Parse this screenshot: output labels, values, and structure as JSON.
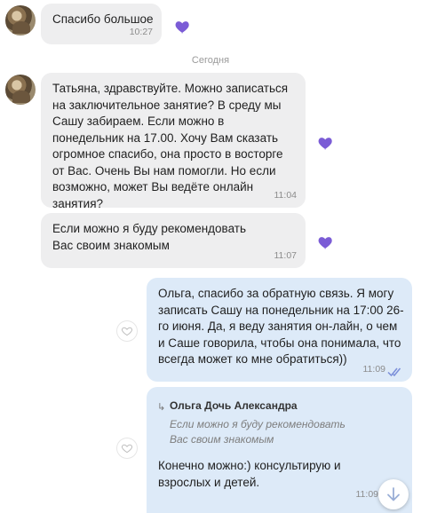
{
  "date_separator": "Сегодня",
  "messages": [
    {
      "text": "Спасибо большое",
      "time": "10:27"
    },
    {
      "text": "Татьяна, здравствуйте. Можно записаться на заключительное занятие? В среду мы Сашу забираем. Если можно в понедельник на 17.00. Хочу Вам сказать огромное спасибо, она просто в восторге от Вас. Очень Вы нам помогли. Но если возможно, может Вы ведёте онлайн занятия?",
      "time": "11:04"
    },
    {
      "text": "Если можно я буду рекомендовать Вас своим знакомым",
      "time": "11:07"
    },
    {
      "text": "Ольга, спасибо за обратную связь. Я могу записать Сашу на понедельник на 17:00 26-го июня.  Да, я веду занятия он-лайн, о чем и Саше говорила, чтобы она понимала, что всегда может ко мне обратиться))",
      "time": "11:09"
    },
    {
      "reply_author": "Ольга Дочь Александра",
      "reply_text": "Если можно я буду рекомендовать Вас своим знакомым",
      "text": "Конечно можно:) консультирую и взрослых и детей.",
      "time": "11:09"
    }
  ],
  "colors": {
    "incoming_bubble": "#eeeeef",
    "outgoing_bubble": "#ddeaf8",
    "reaction_heart": "#7b5cd6",
    "read_ticks": "#7b8fd9"
  },
  "icons": [
    "avatar",
    "purple-heart-icon",
    "heart-outline-icon",
    "reply-arrow-icon",
    "double-check-icon",
    "arrow-down-icon"
  ]
}
